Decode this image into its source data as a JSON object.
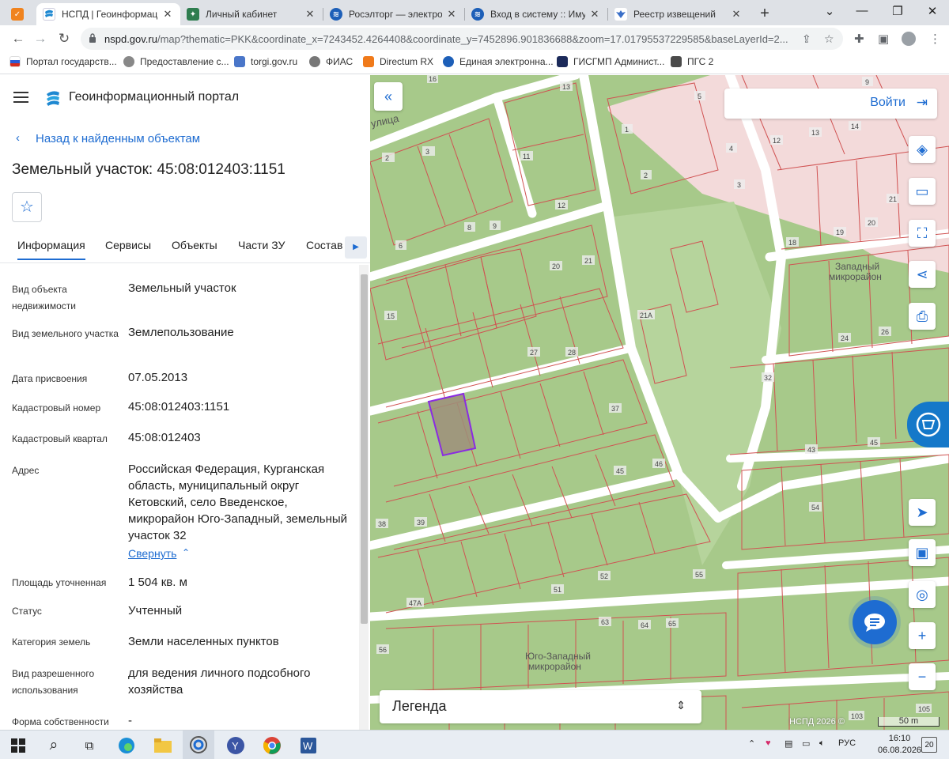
{
  "browser": {
    "tabs": [
      {
        "title": "НСПД | Геоинформаци",
        "active": true,
        "favicon": "nspd-icon"
      },
      {
        "title": "Личный кабинет",
        "active": false,
        "favicon": "cabinet-icon"
      },
      {
        "title": "Росэлторг — электрон",
        "active": false,
        "favicon": "roseltorg-icon"
      },
      {
        "title": "Вход в систему :: Имущ",
        "active": false,
        "favicon": "roseltorg-icon"
      },
      {
        "title": "Реестр извещений",
        "active": false,
        "favicon": "eagle-icon"
      }
    ],
    "url_host": "nspd.gov.ru",
    "url_rest": "/map?thematic=PKK&coordinate_x=7243452.4264408&coordinate_y=7452896.901836688&zoom=17.01795537229585&baseLayerId=2...",
    "bookmarks": [
      "Портал государств...",
      "Предоставление с...",
      "torgi.gov.ru",
      "ФИАС",
      "Directum RX",
      "Единая электронна...",
      "ГИСГМП Админист...",
      "ПГС 2"
    ]
  },
  "portal": {
    "title": "Геоинформационный портал",
    "back_label": "Назад к найденным объектам",
    "object_title": "Земельный участок: 45:08:012403:1151",
    "tabs": [
      "Информация",
      "Сервисы",
      "Объекты",
      "Части ЗУ",
      "Состав"
    ],
    "fields": [
      {
        "label": "Вид объекта недвижимости",
        "value": "Земельный участок"
      },
      {
        "label": "Вид земельного участка",
        "value": "Землепользование"
      },
      {
        "label": "Дата присвоения",
        "value": "07.05.2013"
      },
      {
        "label": "Кадастровый номер",
        "value": "45:08:012403:1151"
      },
      {
        "label": "Кадастровый квартал",
        "value": "45:08:012403"
      },
      {
        "label": "Адрес",
        "value": "Российская Федерация, Курганская область, муниципальный округ Кетовский, село Введенское, микрорайон Юго-Западный, земельный участок 32"
      },
      {
        "label": "Площадь уточненная",
        "value": "1 504 кв. м"
      },
      {
        "label": "Статус",
        "value": "Учтенный"
      },
      {
        "label": "Категория земель",
        "value": "Земли населенных пунктов"
      },
      {
        "label": "Вид разрешенного использования",
        "value": "для ведения личного подсобного хозяйства"
      },
      {
        "label": "Форма собственности",
        "value": "-"
      }
    ],
    "collapse_label": "Свернуть"
  },
  "map": {
    "login_label": "Войти",
    "legend_label": "Легенда",
    "copyright": "НСПД 2026 ©",
    "scale_label": "50 m",
    "street_label": "улица",
    "district_labels": [
      "Западный",
      "микрорайон",
      "Юго-Западный",
      "микрорайон"
    ],
    "parcel_numbers": [
      "16",
      "13",
      "9",
      "5",
      "2",
      "3",
      "11",
      "1",
      "12",
      "4",
      "3",
      "14",
      "12",
      "13",
      "18",
      "19",
      "20",
      "21",
      "8",
      "9",
      "6",
      "2",
      "20",
      "21",
      "15",
      "21А",
      "24",
      "26",
      "27",
      "28",
      "32",
      "37",
      "43",
      "45",
      "46",
      "45",
      "38",
      "39",
      "54",
      "52",
      "55",
      "51",
      "47А",
      "63",
      "64",
      "65",
      "56",
      "103",
      "105"
    ],
    "colors": {
      "green": "#a7c98a",
      "pink": "#f3dada",
      "road": "#ffffff",
      "boundary": "#d05252",
      "selected": "#8a2be2",
      "accent": "#1e6cd1"
    }
  },
  "taskbar": {
    "lang": "РУС",
    "time": "16:10",
    "date": "06.08.2026",
    "notifications": "20"
  }
}
